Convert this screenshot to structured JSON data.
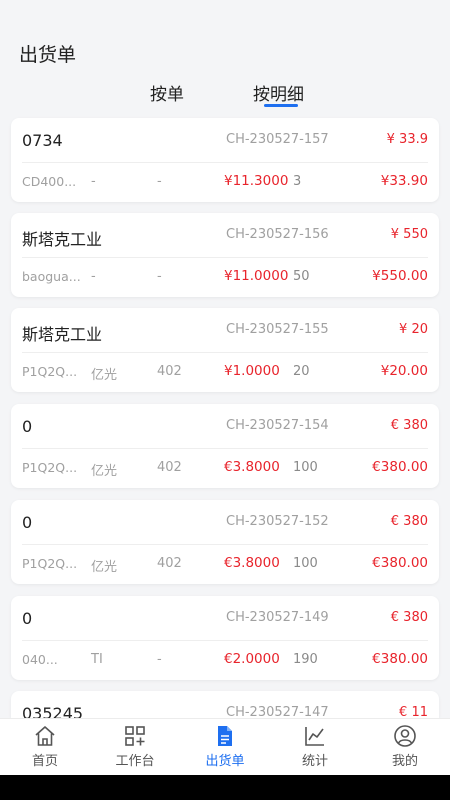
{
  "header": {
    "title": "出货单",
    "tabs": [
      "按单",
      "按明细"
    ],
    "active_tab": 1
  },
  "orders": [
    {
      "name": "0734",
      "code": "CH-230527-157",
      "total": "¥ 33.9",
      "item": "CD400...",
      "brand": "-",
      "spec": "-",
      "price": "¥11.3000",
      "qty": "3",
      "amount": "¥33.90"
    },
    {
      "name": "斯塔克工业",
      "code": "CH-230527-156",
      "total": "¥ 550",
      "item": "baogua...",
      "brand": "-",
      "spec": "-",
      "price": "¥11.0000",
      "qty": "50",
      "amount": "¥550.00"
    },
    {
      "name": "斯塔克工业",
      "code": "CH-230527-155",
      "total": "¥ 20",
      "item": "P1Q2Q...",
      "brand": "亿光",
      "spec": "402",
      "price": "¥1.0000",
      "qty": "20",
      "amount": "¥20.00"
    },
    {
      "name": "0",
      "code": "CH-230527-154",
      "total": "€ 380",
      "item": "P1Q2Q...",
      "brand": "亿光",
      "spec": "402",
      "price": "€3.8000",
      "qty": "100",
      "amount": "€380.00"
    },
    {
      "name": "0",
      "code": "CH-230527-152",
      "total": "€ 380",
      "item": "P1Q2Q...",
      "brand": "亿光",
      "spec": "402",
      "price": "€3.8000",
      "qty": "100",
      "amount": "€380.00"
    },
    {
      "name": "0",
      "code": "CH-230527-149",
      "total": "€ 380",
      "item": "040...",
      "brand": "TI",
      "spec": "-",
      "price": "€2.0000",
      "qty": "190",
      "amount": "€380.00"
    },
    {
      "name": "035245",
      "code": "CH-230527-147",
      "total": "€ 11",
      "item": "",
      "brand": "",
      "spec": "",
      "price": "",
      "qty": "",
      "amount": ""
    }
  ],
  "nav": {
    "items": [
      {
        "label": "首页",
        "icon": "home-icon"
      },
      {
        "label": "工作台",
        "icon": "workbench-icon"
      },
      {
        "label": "出货单",
        "icon": "document-icon"
      },
      {
        "label": "统计",
        "icon": "chart-icon"
      },
      {
        "label": "我的",
        "icon": "user-icon"
      }
    ],
    "active_index": 2
  },
  "colors": {
    "accent": "#1e6ff0",
    "price_red": "#e8242c",
    "muted_text": "#a0a0a0",
    "background": "#f4f5f7"
  }
}
